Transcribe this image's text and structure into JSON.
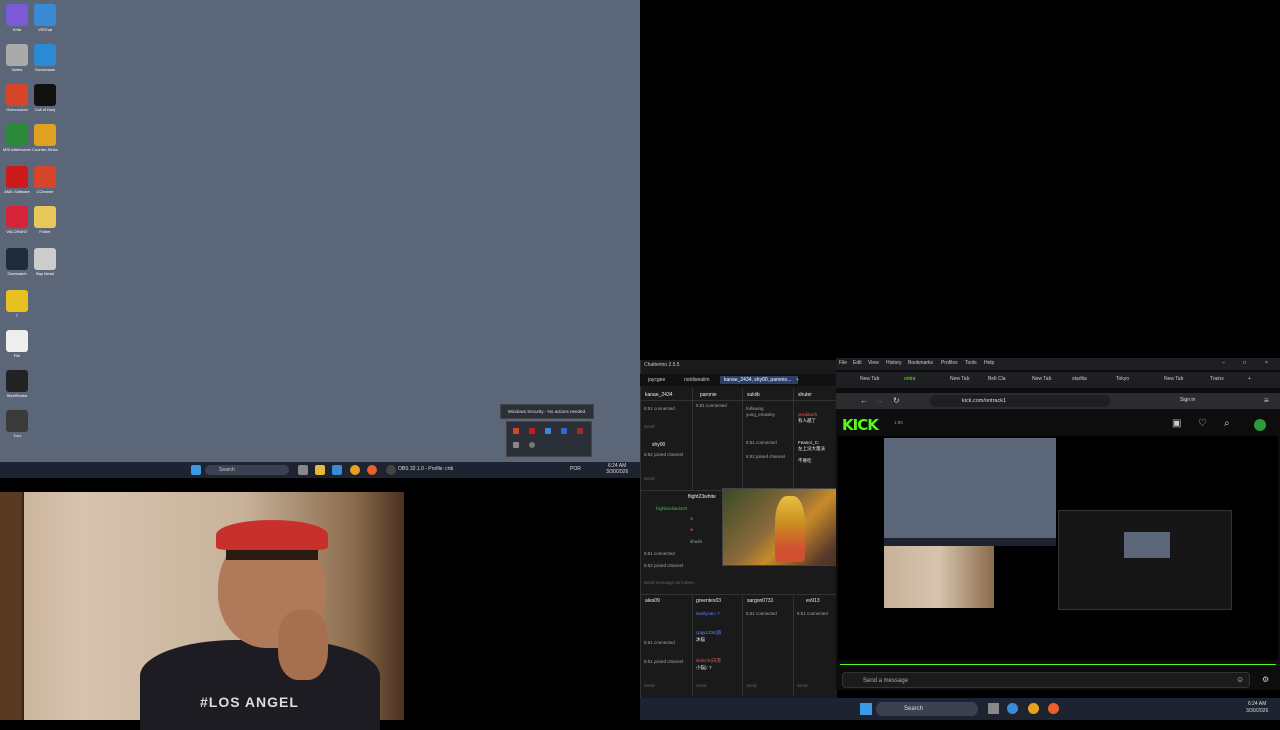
{
  "desktop": {
    "icons": [
      {
        "label": "Krita",
        "color": "#7b5bd6"
      },
      {
        "label": "VRChat",
        "color": "#3a8ad6"
      },
      {
        "label": "Notes",
        "color": "#aaaaaa"
      },
      {
        "label": "Downloads",
        "color": "#2a8ad6"
      },
      {
        "label": "Overcooked",
        "color": "#d6452a"
      },
      {
        "label": "Call of Duty",
        "color": "#111111"
      },
      {
        "label": "MSI Afterburner",
        "color": "#2a8a3a"
      },
      {
        "label": "Counter-Strike",
        "color": "#e0a020"
      },
      {
        "label": "AMD Software",
        "color": "#cc1a1a"
      },
      {
        "label": "CCleaner",
        "color": "#d6452a"
      },
      {
        "label": "VALORANT",
        "color": "#d6243a"
      },
      {
        "label": "Folder",
        "color": "#e8c85a"
      },
      {
        "label": "Overwatch",
        "color": "#1f2a3a"
      },
      {
        "label": "Bay Metal",
        "color": "#cccccc"
      },
      {
        "label": "T",
        "color": "#e8c020"
      },
      {
        "label": "File",
        "color": "#eeeeee"
      },
      {
        "label": "SteelSeries",
        "color": "#222222"
      },
      {
        "label": "Tool",
        "color": "#3a3a3a"
      }
    ],
    "toast": "Windows Security - No actions needed.",
    "taskbar_search": "Search",
    "taskbar_app": "OBS 32.1.0 - Profile: cnb",
    "lang": "POR",
    "time": "6:24 AM",
    "date": "3/30/2026"
  },
  "webcam": {
    "shirt_text": "#LOS ANGEL"
  },
  "chatterino": {
    "title": "Chatterino 2.5.5",
    "tabs": [
      "jaycgee",
      "notdianalim",
      "kanae_2434, shy00, paronio...",
      "+"
    ],
    "row1_headers": [
      "kanae_2434",
      "paronie",
      "sukiib",
      "shuter"
    ],
    "row1_msgs": {
      "a1": "5:51 connected",
      "a2": "shy00",
      "a3": "5:52 joined channel",
      "b1": "5:51 connected",
      "c1": "following",
      "c2": "yung_emasley",
      "c3": "5:51 connected",
      "c4": "5:52 joined channel",
      "d1": "predatorh",
      "d2": "有人越了",
      "d3": "Feanor_C:",
      "d4": "左上没大量派",
      "d5": "不要吃"
    },
    "send": "Send",
    "row2_header": "flight23white",
    "row2_msgs": {
      "m1": "highlimdiaid420",
      "m2": "w",
      "m3": "w",
      "m4": "shush",
      "m5": "5:51 connected",
      "m6": "5:52 joined channel",
      "ph": "Send message as kobee..."
    },
    "row3_headers": [
      "ales09",
      "greentex03",
      "sargon0731",
      "ev913"
    ],
    "row3_msgs": {
      "a1": "5:51 connected",
      "a2": "5:51 joined channel",
      "b1": "ivanlycan: ?",
      "b2": "cpgy1234(嵌",
      "b3": "沐猫",
      "b4": "stsfcrrk(白雪",
      "b5": "小猫): ?",
      "c1": "5:51 connected",
      "d1": "5:51 connected"
    }
  },
  "browser": {
    "menus": [
      "File",
      "Edit",
      "View",
      "History",
      "Bookmarks",
      "Profiles",
      "Tools",
      "Help"
    ],
    "tabs": [
      "New Tab",
      "ontra",
      "New Tab",
      "Belt Cla",
      "New Tab",
      "starlita",
      "Tokyo",
      "New Tab",
      "Trains"
    ],
    "url": "kick.com/ontrack1",
    "sign_in": "Sign in",
    "logo": "KICK",
    "live": "1:00",
    "chat_placeholder": "Send a message",
    "accent": "#53fc18"
  },
  "taskbar2": {
    "search": "Search",
    "time": "6:24 AM",
    "date": "3/30/2026"
  }
}
